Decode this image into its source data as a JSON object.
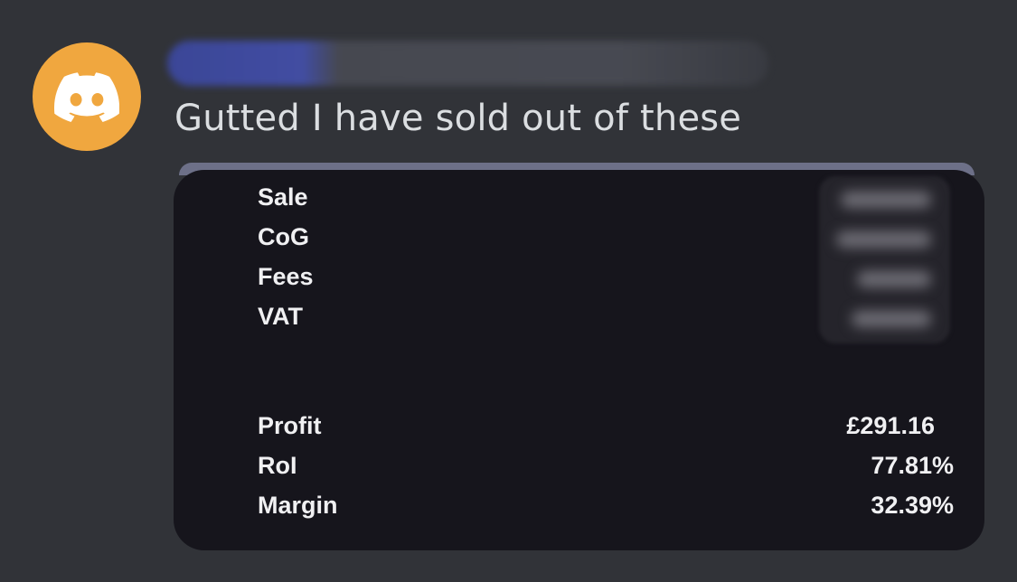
{
  "message": {
    "author_icon": "discord-logo-icon",
    "avatar_color": "#f0a73f",
    "text": "Gutted I have sold out of these"
  },
  "embed": {
    "rows": [
      {
        "label": "Sale"
      },
      {
        "label": "CoG"
      },
      {
        "label": "Fees"
      },
      {
        "label": "VAT"
      }
    ],
    "summary": [
      {
        "label": "Profit",
        "value": "£291.16"
      },
      {
        "label": "RoI",
        "value": "77.81%"
      },
      {
        "label": "Margin",
        "value": "32.39%"
      }
    ]
  }
}
